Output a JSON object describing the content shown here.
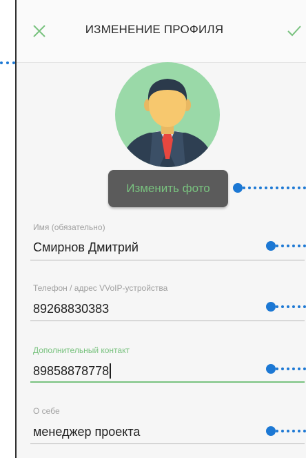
{
  "header": {
    "title": "ИЗМЕНЕНИЕ ПРОФИЛЯ",
    "close_icon": "close-icon",
    "confirm_icon": "checkmark-icon"
  },
  "avatar": {
    "icon": "user-avatar-icon"
  },
  "photo_button": {
    "label": "Изменить фото"
  },
  "fields": [
    {
      "label": "Имя (обязательно)",
      "value": "Смирнов Дмитрий"
    },
    {
      "label": "Телефон / адрес VVoIP-устройства",
      "value": "89268830383"
    },
    {
      "label": "Дополнительный контакт",
      "value": "89858878778"
    },
    {
      "label": "О себе",
      "value": "менеджер проекта"
    }
  ],
  "colors": {
    "accent": "#79c27f",
    "callout": "#1c78d4",
    "button_bg": "#5b5b5b",
    "label": "#a0a0a0",
    "text": "#1f1f1f"
  }
}
